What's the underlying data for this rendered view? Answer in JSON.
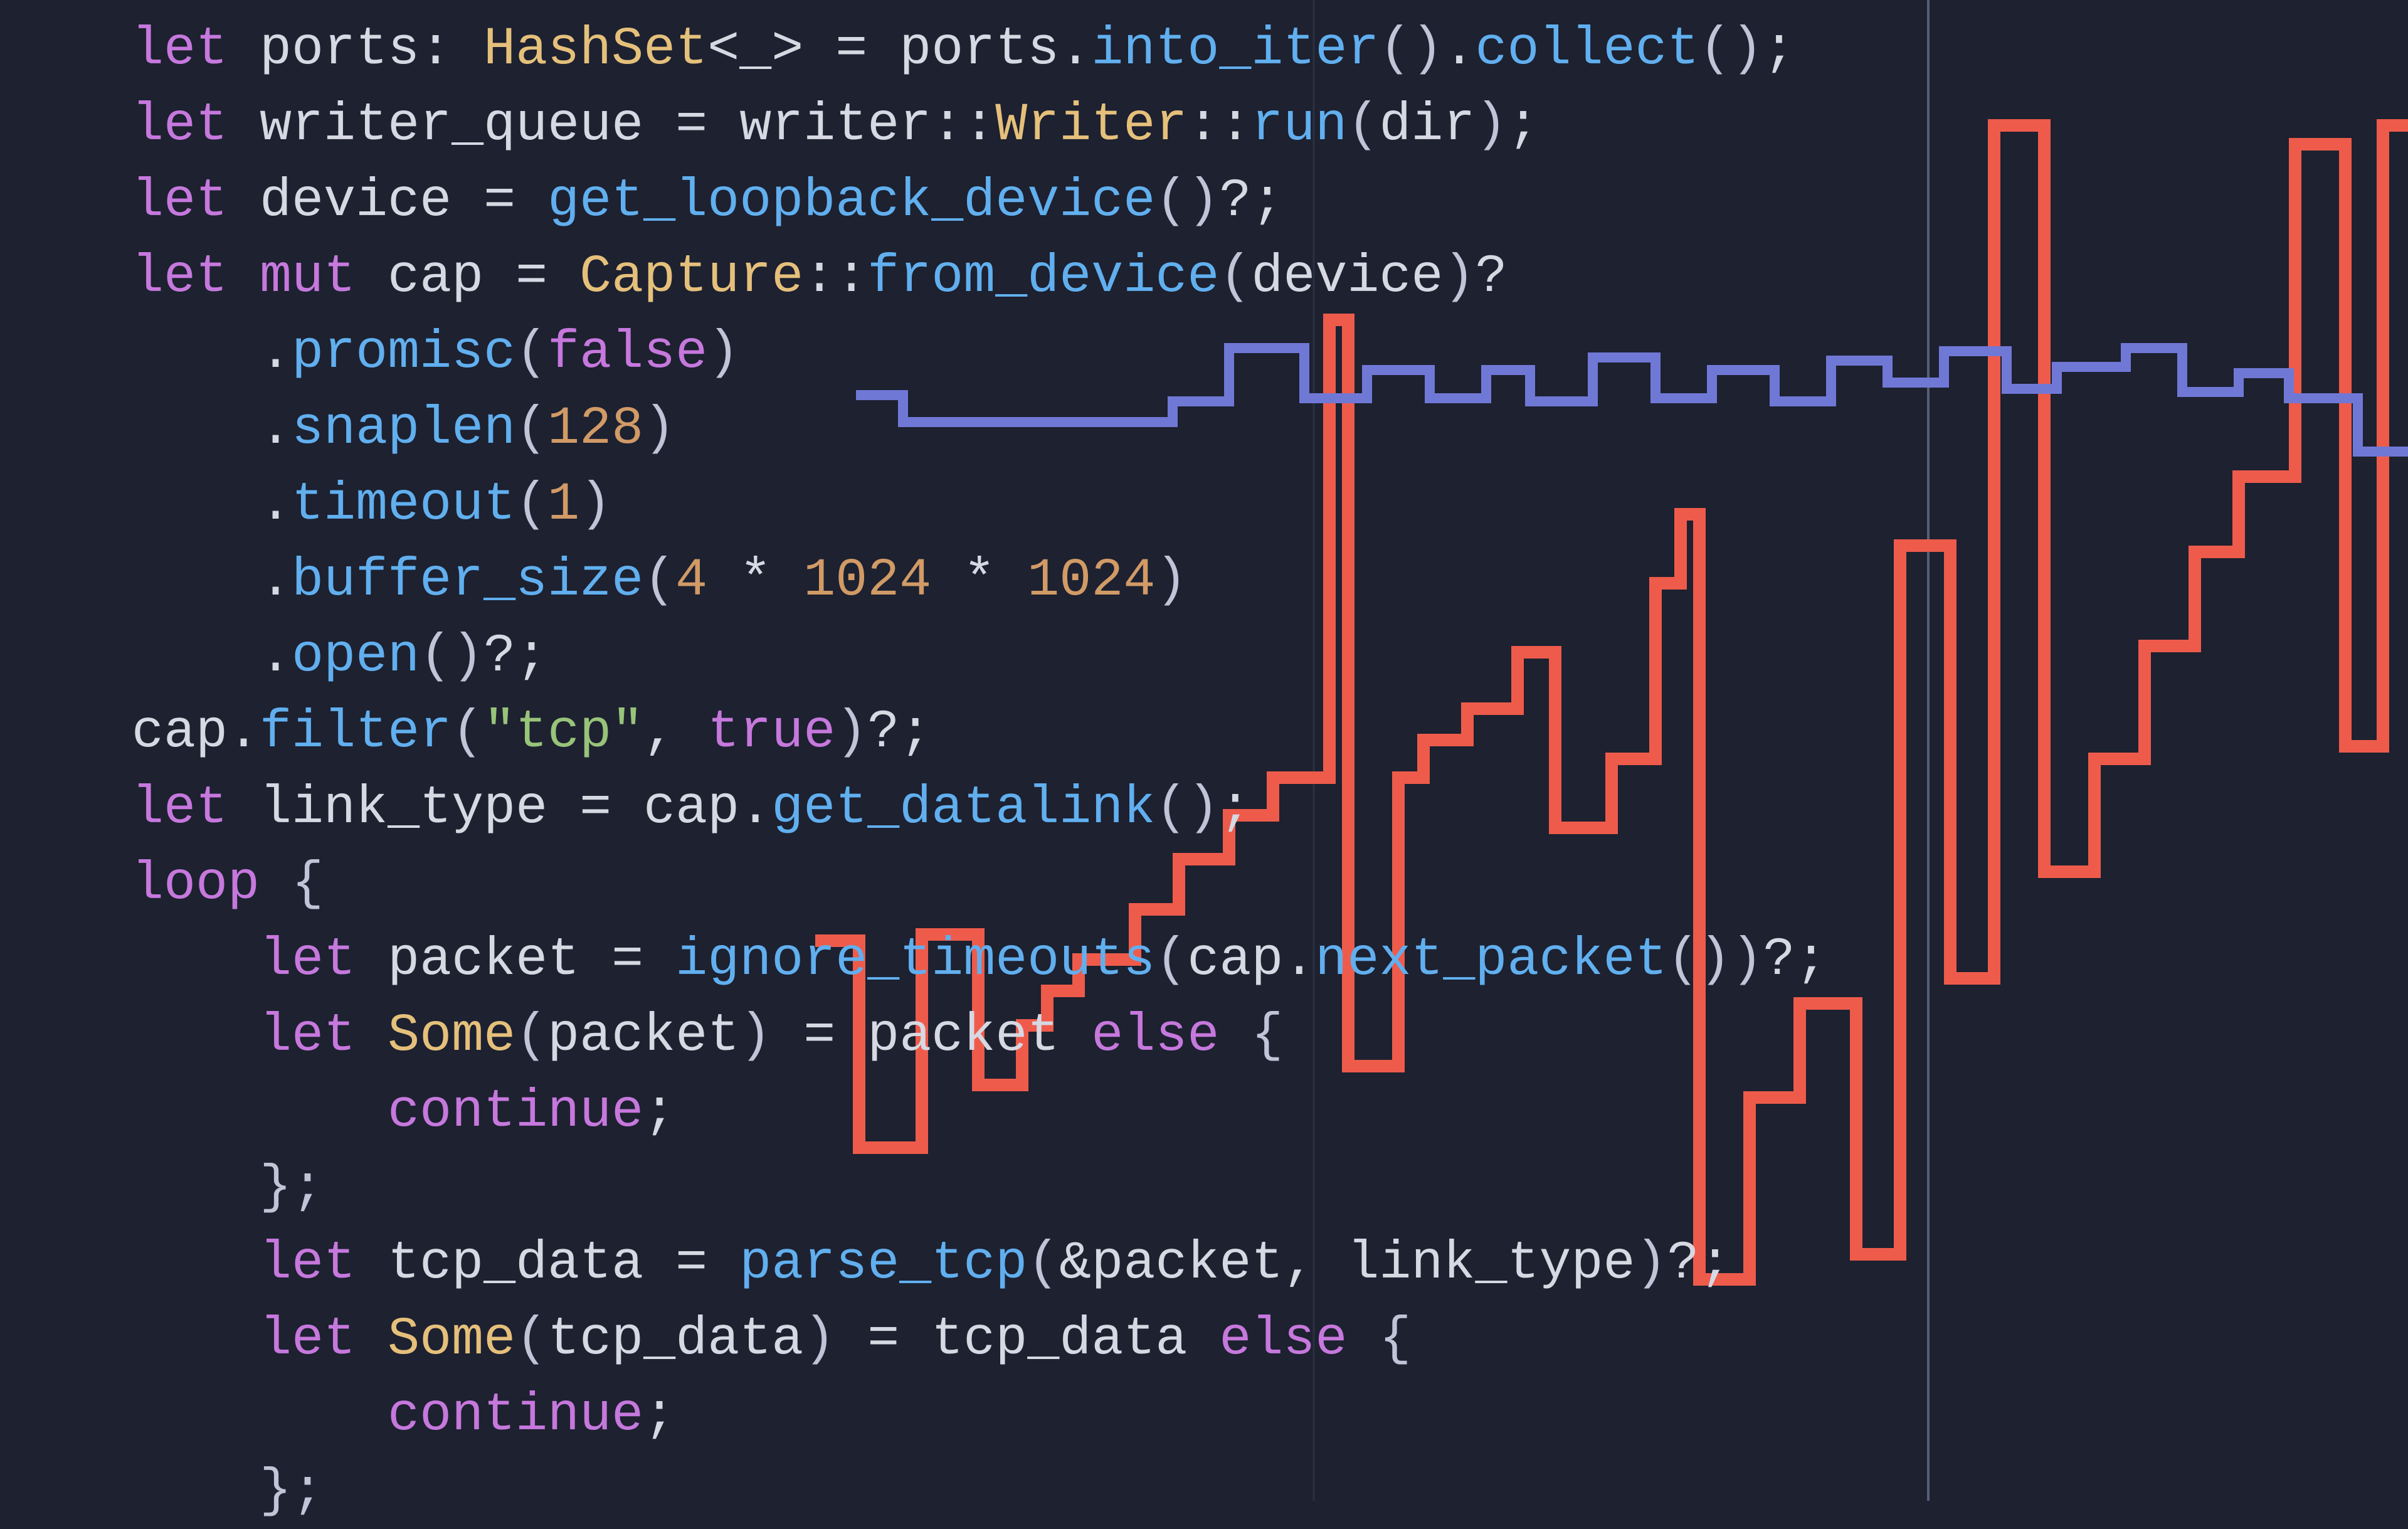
{
  "colors": {
    "bg": "#1d2130",
    "red_series": "#ee5b4b",
    "blue_series": "#7078d6",
    "grid": "#2b3040",
    "grid_strong": "#556078",
    "kw": "#c678dd",
    "call": "#61afef",
    "type": "#e5c07b",
    "num": "#d19a66",
    "str": "#98c379",
    "text": "#d6d8e2"
  },
  "chart_data": {
    "type": "line",
    "title": "",
    "xlabel": "",
    "ylabel": "",
    "xlim": [
      0,
      3840
    ],
    "ylim": [
      0,
      2393
    ],
    "grid": {
      "y_lines": [
        0,
        600,
        1200,
        1800,
        2393
      ],
      "x_lines": [
        2095,
        3075
      ],
      "x_strong": [
        3075
      ]
    },
    "series": [
      {
        "name": "red",
        "color": "#ee5b4b",
        "x": [
          1300,
          1370,
          1370,
          1470,
          1470,
          1560,
          1560,
          1630,
          1630,
          1670,
          1670,
          1720,
          1720,
          1810,
          1810,
          1880,
          1880,
          1960,
          1960,
          2030,
          2030,
          2120,
          2120,
          2150,
          2150,
          2230,
          2230,
          2270,
          2270,
          2340,
          2340,
          2420,
          2420,
          2480,
          2480,
          2570,
          2570,
          2640,
          2640,
          2680,
          2680,
          2710,
          2710,
          2790,
          2790,
          2870,
          2870,
          2960,
          2960,
          3030,
          3030,
          3110,
          3110,
          3180,
          3180,
          3260,
          3260,
          3340,
          3340,
          3420,
          3420,
          3500,
          3500,
          3570,
          3570,
          3660,
          3660,
          3740,
          3740,
          3800,
          3800,
          3840
        ],
        "values": [
          1500,
          1500,
          1830,
          1830,
          1490,
          1490,
          1730,
          1730,
          1635,
          1635,
          1580,
          1580,
          1530,
          1530,
          1450,
          1450,
          1370,
          1370,
          1300,
          1300,
          1240,
          1240,
          510,
          510,
          1700,
          1700,
          1240,
          1240,
          1180,
          1180,
          1130,
          1130,
          1040,
          1040,
          1320,
          1320,
          1210,
          1210,
          930,
          930,
          820,
          820,
          2040,
          2040,
          1750,
          1750,
          1600,
          1600,
          2000,
          2000,
          870,
          870,
          1560,
          1560,
          200,
          200,
          1390,
          1390,
          1210,
          1210,
          1030,
          1030,
          880,
          880,
          760,
          760,
          230,
          230,
          1190,
          1190,
          200,
          200
        ]
      },
      {
        "name": "blue",
        "color": "#7078d6",
        "x": [
          1365,
          1440,
          1440,
          1870,
          1870,
          1960,
          1960,
          2080,
          2080,
          2180,
          2180,
          2280,
          2280,
          2370,
          2370,
          2440,
          2440,
          2540,
          2540,
          2640,
          2640,
          2730,
          2730,
          2830,
          2830,
          2920,
          2920,
          3010,
          3010,
          3100,
          3100,
          3200,
          3200,
          3280,
          3280,
          3390,
          3390,
          3480,
          3480,
          3570,
          3570,
          3650,
          3650,
          3760,
          3760,
          3840
        ],
        "values": [
          630,
          630,
          673,
          673,
          640,
          640,
          555,
          555,
          635,
          635,
          590,
          590,
          635,
          635,
          590,
          590,
          640,
          640,
          570,
          570,
          635,
          635,
          590,
          590,
          640,
          640,
          575,
          575,
          610,
          610,
          560,
          560,
          620,
          620,
          585,
          585,
          555,
          555,
          625,
          625,
          595,
          595,
          635,
          635,
          720,
          720
        ]
      }
    ]
  },
  "code": {
    "lines": [
      [
        [
          "kw",
          "let"
        ],
        [
          "id",
          " ports"
        ],
        [
          "op",
          ": "
        ],
        [
          "type",
          "HashSet"
        ],
        [
          "op",
          "<"
        ],
        [
          "id",
          "_"
        ],
        [
          "op",
          ">"
        ],
        [
          "op",
          " = "
        ],
        [
          "id",
          "ports"
        ],
        [
          "op",
          "."
        ],
        [
          "call",
          "into_iter"
        ],
        [
          "par",
          "()"
        ],
        [
          "op",
          "."
        ],
        [
          "call",
          "collect"
        ],
        [
          "par",
          "()"
        ],
        [
          "op",
          ";"
        ]
      ],
      [
        [
          "kw",
          "let"
        ],
        [
          "id",
          " writer_queue "
        ],
        [
          "op",
          "= "
        ],
        [
          "id",
          "writer"
        ],
        [
          "col",
          "::"
        ],
        [
          "type",
          "Writer"
        ],
        [
          "col",
          "::"
        ],
        [
          "call",
          "run"
        ],
        [
          "par",
          "("
        ],
        [
          "id",
          "dir"
        ],
        [
          "par",
          ")"
        ],
        [
          "op",
          ";"
        ]
      ],
      [
        [
          "kw",
          "let"
        ],
        [
          "id",
          " device "
        ],
        [
          "op",
          "= "
        ],
        [
          "call",
          "get_loopback_device"
        ],
        [
          "par",
          "()"
        ],
        [
          "op",
          "?;"
        ]
      ],
      [
        [
          "kw",
          "let"
        ],
        [
          "id",
          " "
        ],
        [
          "kw",
          "mut"
        ],
        [
          "id",
          " cap "
        ],
        [
          "op",
          "= "
        ],
        [
          "type",
          "Capture"
        ],
        [
          "col",
          "::"
        ],
        [
          "call",
          "from_device"
        ],
        [
          "par",
          "("
        ],
        [
          "id",
          "device"
        ],
        [
          "par",
          ")"
        ],
        [
          "op",
          "?"
        ]
      ],
      [
        [
          "id",
          "    "
        ],
        [
          "op",
          "."
        ],
        [
          "call",
          "promisc"
        ],
        [
          "par",
          "("
        ],
        [
          "kw",
          "false"
        ],
        [
          "par",
          ")"
        ]
      ],
      [
        [
          "id",
          "    "
        ],
        [
          "op",
          "."
        ],
        [
          "call",
          "snaplen"
        ],
        [
          "par",
          "("
        ],
        [
          "num",
          "128"
        ],
        [
          "par",
          ")"
        ]
      ],
      [
        [
          "id",
          "    "
        ],
        [
          "op",
          "."
        ],
        [
          "call",
          "timeout"
        ],
        [
          "par",
          "("
        ],
        [
          "num",
          "1"
        ],
        [
          "par",
          ")"
        ]
      ],
      [
        [
          "id",
          "    "
        ],
        [
          "op",
          "."
        ],
        [
          "call",
          "buffer_size"
        ],
        [
          "par",
          "("
        ],
        [
          "num",
          "4"
        ],
        [
          "op",
          " * "
        ],
        [
          "num",
          "1024"
        ],
        [
          "op",
          " * "
        ],
        [
          "num",
          "1024"
        ],
        [
          "par",
          ")"
        ]
      ],
      [
        [
          "id",
          "    "
        ],
        [
          "op",
          "."
        ],
        [
          "call",
          "open"
        ],
        [
          "par",
          "()"
        ],
        [
          "op",
          "?;"
        ]
      ],
      [
        [
          "id",
          "cap"
        ],
        [
          "op",
          "."
        ],
        [
          "call",
          "filter"
        ],
        [
          "par",
          "("
        ],
        [
          "str",
          "\"tcp\""
        ],
        [
          "op",
          ", "
        ],
        [
          "kw",
          "true"
        ],
        [
          "par",
          ")"
        ],
        [
          "op",
          "?;"
        ]
      ],
      [
        [
          "kw",
          "let"
        ],
        [
          "id",
          " link_type "
        ],
        [
          "op",
          "= "
        ],
        [
          "id",
          "cap"
        ],
        [
          "op",
          "."
        ],
        [
          "call",
          "get_datalink"
        ],
        [
          "par",
          "()"
        ],
        [
          "op",
          ";"
        ]
      ],
      [
        [
          "kw",
          "loop"
        ],
        [
          "id",
          " "
        ],
        [
          "par",
          "{"
        ]
      ],
      [
        [
          "id",
          "    "
        ],
        [
          "kw",
          "let"
        ],
        [
          "id",
          " packet "
        ],
        [
          "op",
          "= "
        ],
        [
          "call",
          "ignore_timeouts"
        ],
        [
          "par",
          "("
        ],
        [
          "id",
          "cap"
        ],
        [
          "op",
          "."
        ],
        [
          "call",
          "next_packet"
        ],
        [
          "par",
          "()"
        ],
        [
          "par",
          ")"
        ],
        [
          "op",
          "?;"
        ]
      ],
      [
        [
          "id",
          "    "
        ],
        [
          "kw",
          "let"
        ],
        [
          "id",
          " "
        ],
        [
          "type",
          "Some"
        ],
        [
          "par",
          "("
        ],
        [
          "id",
          "packet"
        ],
        [
          "par",
          ")"
        ],
        [
          "id",
          " "
        ],
        [
          "op",
          "= "
        ],
        [
          "id",
          "packet "
        ],
        [
          "kw",
          "else"
        ],
        [
          "id",
          " "
        ],
        [
          "par",
          "{"
        ]
      ],
      [
        [
          "id",
          "        "
        ],
        [
          "kw",
          "continue"
        ],
        [
          "op",
          ";"
        ]
      ],
      [
        [
          "id",
          "    "
        ],
        [
          "par",
          "};"
        ]
      ],
      [
        [
          "id",
          "    "
        ],
        [
          "kw",
          "let"
        ],
        [
          "id",
          " tcp_data "
        ],
        [
          "op",
          "= "
        ],
        [
          "call",
          "parse_tcp"
        ],
        [
          "par",
          "("
        ],
        [
          "op",
          "&"
        ],
        [
          "id",
          "packet"
        ],
        [
          "op",
          ", "
        ],
        [
          "id",
          "link_type"
        ],
        [
          "par",
          ")"
        ],
        [
          "op",
          "?;"
        ]
      ],
      [
        [
          "id",
          "    "
        ],
        [
          "kw",
          "let"
        ],
        [
          "id",
          " "
        ],
        [
          "type",
          "Some"
        ],
        [
          "par",
          "("
        ],
        [
          "id",
          "tcp_data"
        ],
        [
          "par",
          ")"
        ],
        [
          "id",
          " "
        ],
        [
          "op",
          "= "
        ],
        [
          "id",
          "tcp_data "
        ],
        [
          "kw",
          "else"
        ],
        [
          "id",
          " "
        ],
        [
          "par",
          "{"
        ]
      ],
      [
        [
          "id",
          "        "
        ],
        [
          "kw",
          "continue"
        ],
        [
          "op",
          ";"
        ]
      ],
      [
        [
          "id",
          "    "
        ],
        [
          "par",
          "};"
        ]
      ]
    ]
  }
}
